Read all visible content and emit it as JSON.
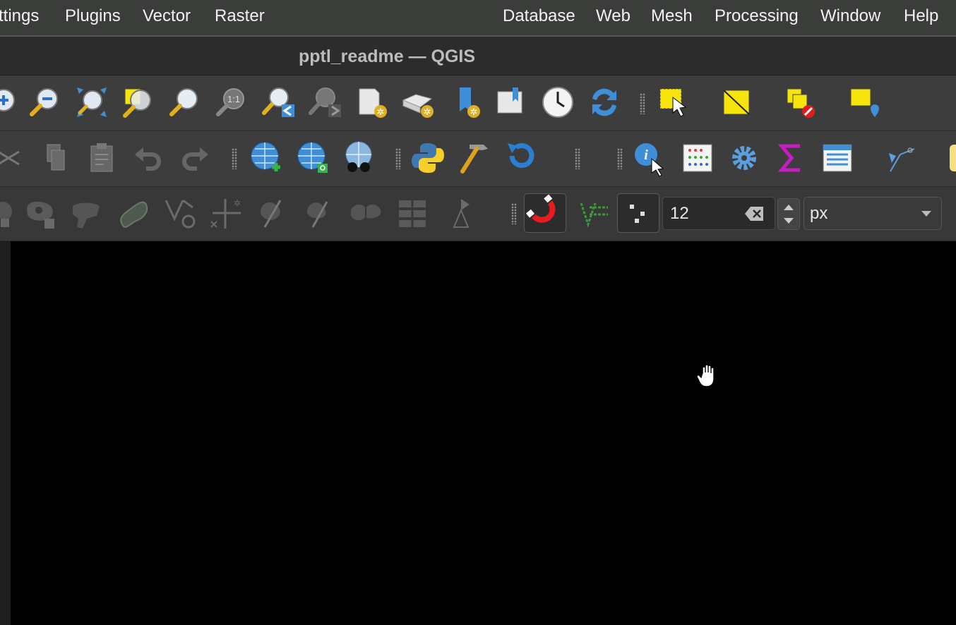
{
  "menubar": {
    "items": [
      "ttings",
      "Plugins",
      "Vector",
      "Raster",
      "Database",
      "Web",
      "Mesh",
      "Processing",
      "Window",
      "Help"
    ]
  },
  "window": {
    "title": "pptl_readme — QGIS"
  },
  "toolbar_icons": {
    "row1": [
      "zoom-in-icon",
      "zoom-out-icon",
      "zoom-full-icon",
      "zoom-to-selection-icon",
      "zoom-to-layer-icon",
      "zoom-native-icon",
      "zoom-last-icon",
      "zoom-next-icon",
      "new-spatial-bookmark-icon",
      "new-3d-map-view-icon",
      "show-spatial-bookmarks-icon",
      "show-bookmarks-manager-icon",
      "temporal-controller-icon",
      "refresh-icon",
      "select-features-icon",
      "select-by-polygon-icon",
      "deselect-features-icon",
      "select-by-location-icon"
    ],
    "row2": [
      "cut-features-icon",
      "copy-features-icon",
      "paste-features-icon",
      "undo-icon",
      "redo-icon",
      "add-wms-layer-icon",
      "add-wfs-layer-icon",
      "metasearch-icon",
      "python-console-icon",
      "processing-toolbox-icon",
      "reload-plugin-icon",
      "identify-features-icon",
      "attribute-table-icon",
      "options-gear-icon",
      "statistics-sum-icon",
      "open-field-calculator-icon",
      "digitize-vertex-icon"
    ],
    "row3": [
      "delete-part-icon",
      "delete-ring-icon",
      "reshape-features-icon",
      "offset-curve-icon",
      "vertex-tool-icon",
      "split-parts-icon",
      "split-features-icon",
      "merge-features-icon",
      "merge-attributes-icon",
      "rotate-point-symbols-icon",
      "triangle-tool-icon",
      "snapping-magnet-icon",
      "snapping-vertex-mode-icon",
      "snapping-type-icon"
    ]
  },
  "snapping": {
    "tolerance_value": "12",
    "unit_value": "px"
  },
  "colors": {
    "menubar_bg": "#3a3d39",
    "toolbar_bg": "#3d3d3d",
    "map_bg": "#000000",
    "accent_yellow": "#f7e40b",
    "accent_blue": "#3f8fd8"
  }
}
